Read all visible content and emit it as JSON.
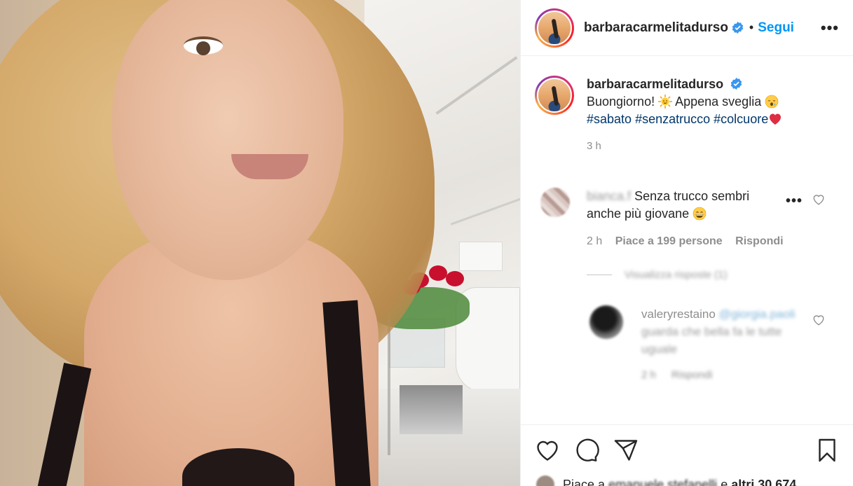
{
  "post": {
    "username": "barbaracarmelitadurso",
    "follow_label": "Segui",
    "separator": "•",
    "more_label": "•••"
  },
  "caption": {
    "username": "barbaracarmelitadurso",
    "text_1": "Buongiorno!",
    "text_2": "Appena sveglia",
    "hashtags": [
      "#sabato",
      "#senzatrucco",
      "#colcuore"
    ],
    "time": "3 h"
  },
  "comment": {
    "username": "bianca.f",
    "text": "Senza trucco sembri anche più giovane",
    "time": "2 h",
    "likes": "Piace a 199 persone",
    "reply_label": "Rispondi",
    "more_label": "•••"
  },
  "view_replies": "Visualizza risposte (1)",
  "reply": {
    "username": "valeryrestaino",
    "mention": "@giorgia.paoli",
    "text": "guarda che bella fa le tutte",
    "text_2": "uguale",
    "time": "2 h",
    "reply_label": "Rispondi"
  },
  "likes_line": {
    "prefix": "Piace a",
    "user": "emanuele.stefanelli",
    "middle": "e",
    "others": "altri 30.674"
  },
  "colors": {
    "accent": "#0095f6",
    "hashtag": "#00376b",
    "muted": "#8e8e8e"
  }
}
